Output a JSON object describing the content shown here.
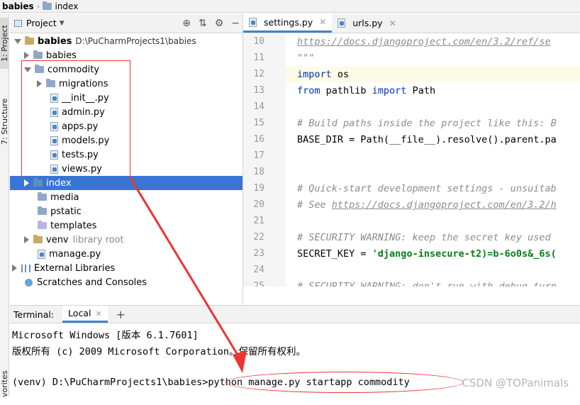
{
  "breadcrumb": {
    "project": "babies",
    "folder": "index"
  },
  "side_tabs": {
    "project": "1: Project",
    "structure": "7: Structure",
    "favorites": "vorites"
  },
  "project_panel": {
    "title": "Project",
    "root": {
      "name": "babies",
      "path": "D:\\PuCharmProjects1\\babies"
    },
    "items": [
      {
        "label": "babies",
        "extra": ""
      },
      {
        "label": "commodity",
        "extra": ""
      },
      {
        "label": "migrations",
        "extra": ""
      },
      {
        "label": "__init__.py",
        "extra": ""
      },
      {
        "label": "admin.py",
        "extra": ""
      },
      {
        "label": "apps.py",
        "extra": ""
      },
      {
        "label": "models.py",
        "extra": ""
      },
      {
        "label": "tests.py",
        "extra": ""
      },
      {
        "label": "views.py",
        "extra": ""
      },
      {
        "label": "index",
        "extra": ""
      },
      {
        "label": "media",
        "extra": ""
      },
      {
        "label": "pstatic",
        "extra": ""
      },
      {
        "label": "templates",
        "extra": ""
      },
      {
        "label": "venv",
        "extra": "library root"
      },
      {
        "label": "manage.py",
        "extra": ""
      },
      {
        "label": "External Libraries",
        "extra": ""
      },
      {
        "label": "Scratches and Consoles",
        "extra": ""
      }
    ]
  },
  "editor_tabs": [
    {
      "label": "settings.py"
    },
    {
      "label": "urls.py"
    }
  ],
  "code_lines": [
    {
      "n": "10",
      "text": "https://docs.djangoproject.com/en/3.2/ref/se"
    },
    {
      "n": "11",
      "text": "\"\"\""
    },
    {
      "n": "12",
      "kw": "import",
      "rest": " os"
    },
    {
      "n": "13",
      "kw": "from",
      "mid": " pathlib ",
      "kw2": "import",
      "rest": " Path"
    },
    {
      "n": "14",
      "text": ""
    },
    {
      "n": "15",
      "text": "# Build paths inside the project like this: B"
    },
    {
      "n": "16",
      "text": "BASE_DIR = Path(__file__).resolve().parent.pa"
    },
    {
      "n": "17",
      "text": ""
    },
    {
      "n": "18",
      "text": ""
    },
    {
      "n": "19",
      "text": "# Quick-start development settings - unsuitab"
    },
    {
      "n": "20",
      "pre": "# See ",
      "link": "https://docs.djangoproject.com/en/3.2/h"
    },
    {
      "n": "21",
      "text": ""
    },
    {
      "n": "22",
      "text": "# SECURITY WARNING: keep the secret key used"
    },
    {
      "n": "23",
      "pre": "SECRET_KEY = ",
      "str": "'django-insecure-t2)=b-6o0s&_6s("
    },
    {
      "n": "24",
      "text": ""
    },
    {
      "n": "25",
      "text": "# SECURITY WARNING: don't run with debug turn"
    }
  ],
  "terminal": {
    "label": "Terminal:",
    "tab": "Local",
    "plus": "+",
    "lines": [
      "Microsoft Windows [版本 6.1.7601]",
      "版权所有 (c) 2009 Microsoft Corporation。保留所有权利。",
      "(venv) D:\\PuCharmProjects1\\babies>python manage.py startapp commodity"
    ]
  },
  "watermark": "CSDN @TOPanimals",
  "colors": {
    "selection": "#3875d7",
    "annotation_red": "#ee3333",
    "keyword": "#0033b3",
    "string": "#067d17"
  }
}
